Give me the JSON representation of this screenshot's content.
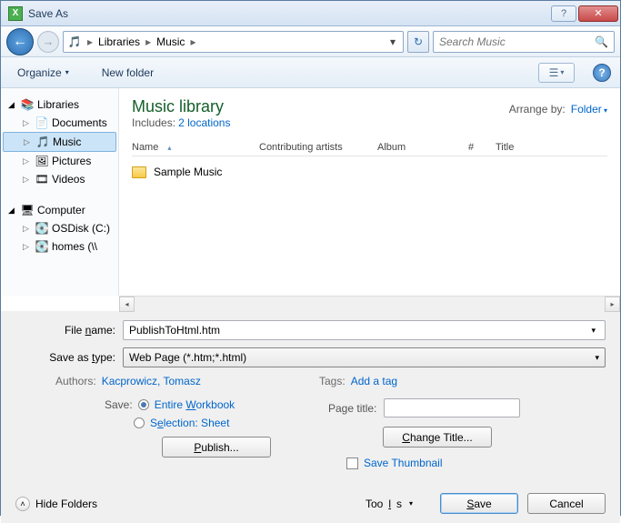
{
  "title": "Save As",
  "nav": {
    "crumbs": [
      "Libraries",
      "Music"
    ],
    "search_placeholder": "Search Music"
  },
  "toolbar": {
    "organize": "Organize",
    "new_folder": "New folder"
  },
  "sidebar": {
    "libraries": "Libraries",
    "documents": "Documents",
    "music": "Music",
    "pictures": "Pictures",
    "videos": "Videos",
    "computer": "Computer",
    "osdisk": "OSDisk (C:)",
    "homes": "homes (\\\\"
  },
  "content": {
    "library_title": "Music library",
    "includes_label": "Includes:",
    "includes_link": "2 locations",
    "arrange_label": "Arrange by:",
    "arrange_value": "Folder",
    "columns": {
      "name": "Name",
      "contrib": "Contributing artists",
      "album": "Album",
      "num": "#",
      "title": "Title"
    },
    "items": [
      {
        "name": "Sample Music",
        "type": "folder"
      }
    ]
  },
  "form": {
    "filename_label": "File name:",
    "filename_value": "PublishToHtml.htm",
    "savetype_label": "Save as type:",
    "savetype_value": "Web Page (*.htm;*.html)",
    "authors_label": "Authors:",
    "authors_value": "Kacprowicz, Tomasz",
    "tags_label": "Tags:",
    "tags_value": "Add a tag",
    "save_label": "Save:",
    "radio_workbook_pre": "Entire ",
    "radio_workbook_u": "W",
    "radio_workbook_post": "orkbook",
    "radio_selection_pre": "S",
    "radio_selection_u": "e",
    "radio_selection_post": "lection: Sheet",
    "publish_u": "P",
    "publish_post": "ublish...",
    "pagetitle_label": "Page title:",
    "pagetitle_value": "",
    "changetitle_u": "C",
    "changetitle_post": "hange Title...",
    "thumbnail": "Save Thumbnail"
  },
  "footer": {
    "hide_folders": "Hide Folders",
    "tools_pre": "Too",
    "tools_u": "l",
    "tools_post": "s",
    "save_u": "S",
    "save_post": "ave",
    "cancel": "Cancel"
  }
}
